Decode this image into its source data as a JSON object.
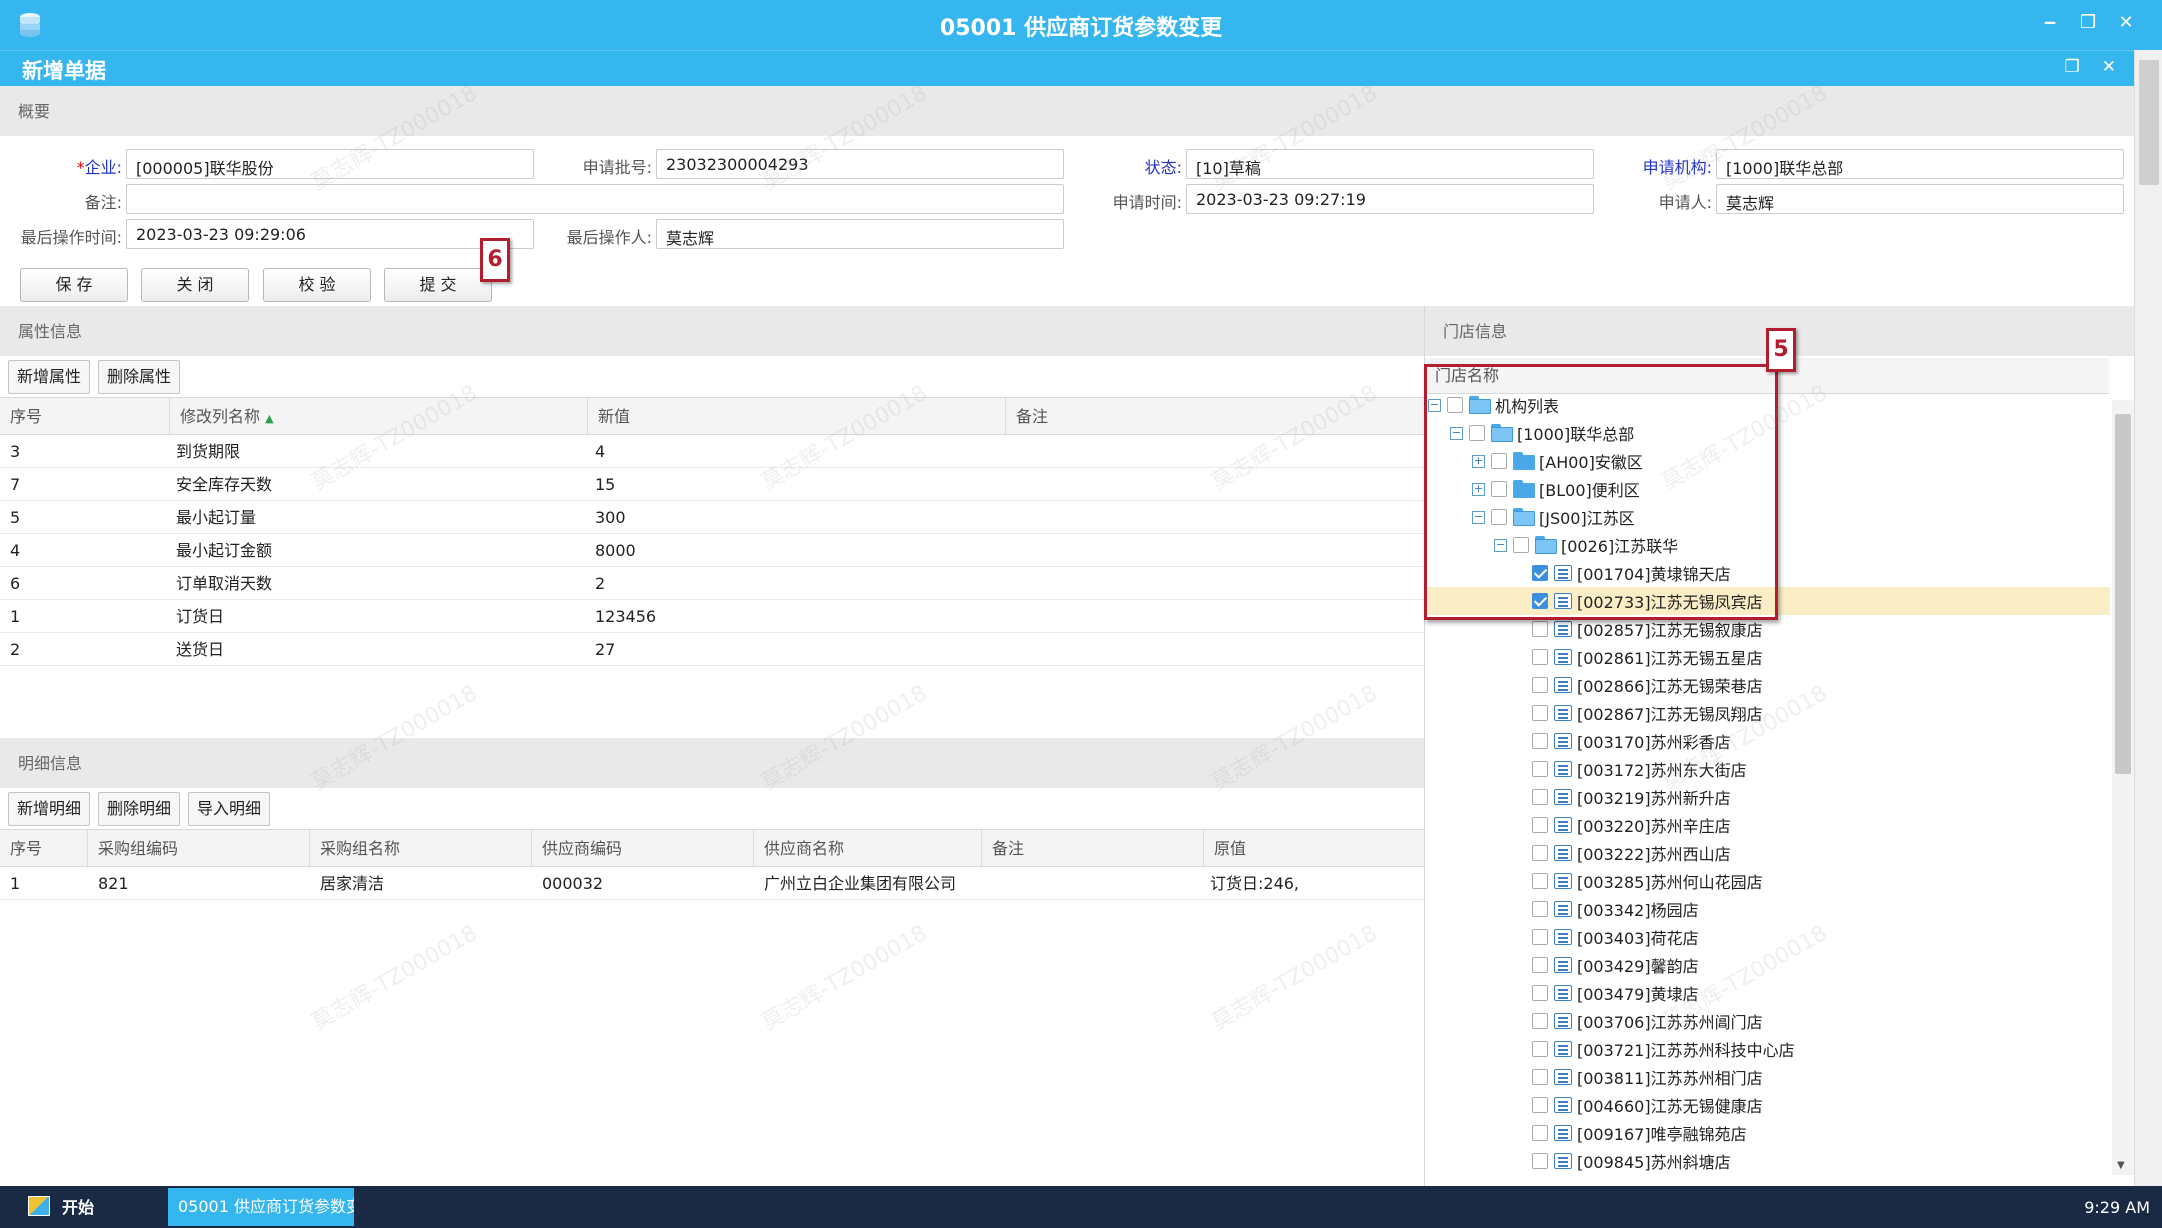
{
  "window": {
    "title": "05001 供应商订货参数变更",
    "controls": [
      "‒",
      "❐",
      "✕"
    ]
  },
  "doc": {
    "title": "新增单据",
    "controls": [
      "❐",
      "✕"
    ]
  },
  "summary": {
    "heading": "概要",
    "fields": {
      "company": {
        "label": "*企业:",
        "value": "[000005]联华股份"
      },
      "batch_no": {
        "label": "申请批号:",
        "value": "23032300004293"
      },
      "status": {
        "label": "状态:",
        "value": "[10]草稿"
      },
      "org": {
        "label": "申请机构:",
        "value": "[1000]联华总部"
      },
      "remark": {
        "label": "备注:",
        "value": ""
      },
      "apply_time": {
        "label": "申请时间:",
        "value": "2023-03-23 09:27:19"
      },
      "applicant": {
        "label": "申请人:",
        "value": "莫志辉"
      },
      "last_op_time": {
        "label": "最后操作时间:",
        "value": "2023-03-23 09:29:06"
      },
      "last_operator": {
        "label": "最后操作人:",
        "value": "莫志辉"
      }
    },
    "buttons": {
      "save": "保 存",
      "close": "关 闭",
      "verify": "校 验",
      "submit": "提 交"
    }
  },
  "annotations": {
    "callout_6": "6",
    "callout_5": "5"
  },
  "attributes": {
    "heading": "属性信息",
    "buttons": {
      "add": "新增属性",
      "delete": "删除属性"
    },
    "columns": [
      "序号",
      "修改列名称",
      "新值",
      "备注"
    ],
    "rows": [
      {
        "no": "3",
        "name": "到货期限",
        "value": "4",
        "remark": ""
      },
      {
        "no": "7",
        "name": "安全库存天数",
        "value": "15",
        "remark": ""
      },
      {
        "no": "5",
        "name": "最小起订量",
        "value": "300",
        "remark": ""
      },
      {
        "no": "4",
        "name": "最小起订金额",
        "value": "8000",
        "remark": ""
      },
      {
        "no": "6",
        "name": "订单取消天数",
        "value": "2",
        "remark": ""
      },
      {
        "no": "1",
        "name": "订货日",
        "value": "123456",
        "remark": ""
      },
      {
        "no": "2",
        "name": "送货日",
        "value": "27",
        "remark": ""
      }
    ]
  },
  "details": {
    "heading": "明细信息",
    "buttons": {
      "add": "新增明细",
      "delete": "删除明细",
      "import": "导入明细"
    },
    "columns": [
      "序号",
      "采购组编码",
      "采购组名称",
      "供应商编码",
      "供应商名称",
      "备注",
      "原值"
    ],
    "rows": [
      {
        "no": "1",
        "group_code": "821",
        "group_name": "居家清洁",
        "supplier_code": "000032",
        "supplier_name": "广州立白企业集团有限公司",
        "remark": "",
        "original": "订货日:246,"
      }
    ]
  },
  "stores": {
    "heading": "门店信息",
    "column": "门店名称",
    "tree": [
      {
        "label": "机构列表",
        "checked": false
      },
      {
        "label": "[1000]联华总部",
        "checked": false
      },
      {
        "label": "[AH00]安徽区",
        "checked": false
      },
      {
        "label": "[BL00]便利区",
        "checked": false
      },
      {
        "label": "[JS00]江苏区",
        "checked": false
      },
      {
        "label": "[0026]江苏联华",
        "checked": false
      },
      {
        "label": "[001704]黄埭锦天店",
        "checked": true
      },
      {
        "label": "[002733]江苏无锡凤宾店",
        "checked": true
      },
      {
        "label": "[002857]江苏无锡叙康店",
        "checked": false
      },
      {
        "label": "[002861]江苏无锡五星店",
        "checked": false
      },
      {
        "label": "[002866]江苏无锡荣巷店",
        "checked": false
      },
      {
        "label": "[002867]江苏无锡凤翔店",
        "checked": false
      },
      {
        "label": "[003170]苏州彩香店",
        "checked": false
      },
      {
        "label": "[003172]苏州东大街店",
        "checked": false
      },
      {
        "label": "[003219]苏州新升店",
        "checked": false
      },
      {
        "label": "[003220]苏州辛庄店",
        "checked": false
      },
      {
        "label": "[003222]苏州西山店",
        "checked": false
      },
      {
        "label": "[003285]苏州何山花园店",
        "checked": false
      },
      {
        "label": "[003342]杨园店",
        "checked": false
      },
      {
        "label": "[003403]荷花店",
        "checked": false
      },
      {
        "label": "[003429]馨韵店",
        "checked": false
      },
      {
        "label": "[003479]黄埭店",
        "checked": false
      },
      {
        "label": "[003706]江苏苏州阊门店",
        "checked": false
      },
      {
        "label": "[003721]江苏苏州科技中心店",
        "checked": false
      },
      {
        "label": "[003811]江苏苏州相门店",
        "checked": false
      },
      {
        "label": "[004660]江苏无锡健康店",
        "checked": false
      },
      {
        "label": "[009167]唯亭融锦苑店",
        "checked": false
      },
      {
        "label": "[009845]苏州斜塘店",
        "checked": false
      }
    ]
  },
  "taskbar": {
    "start": "开始",
    "task": "05001 供应商订货参数变",
    "clock": "9:29 AM"
  },
  "watermark": "莫志辉-TZ000018"
}
